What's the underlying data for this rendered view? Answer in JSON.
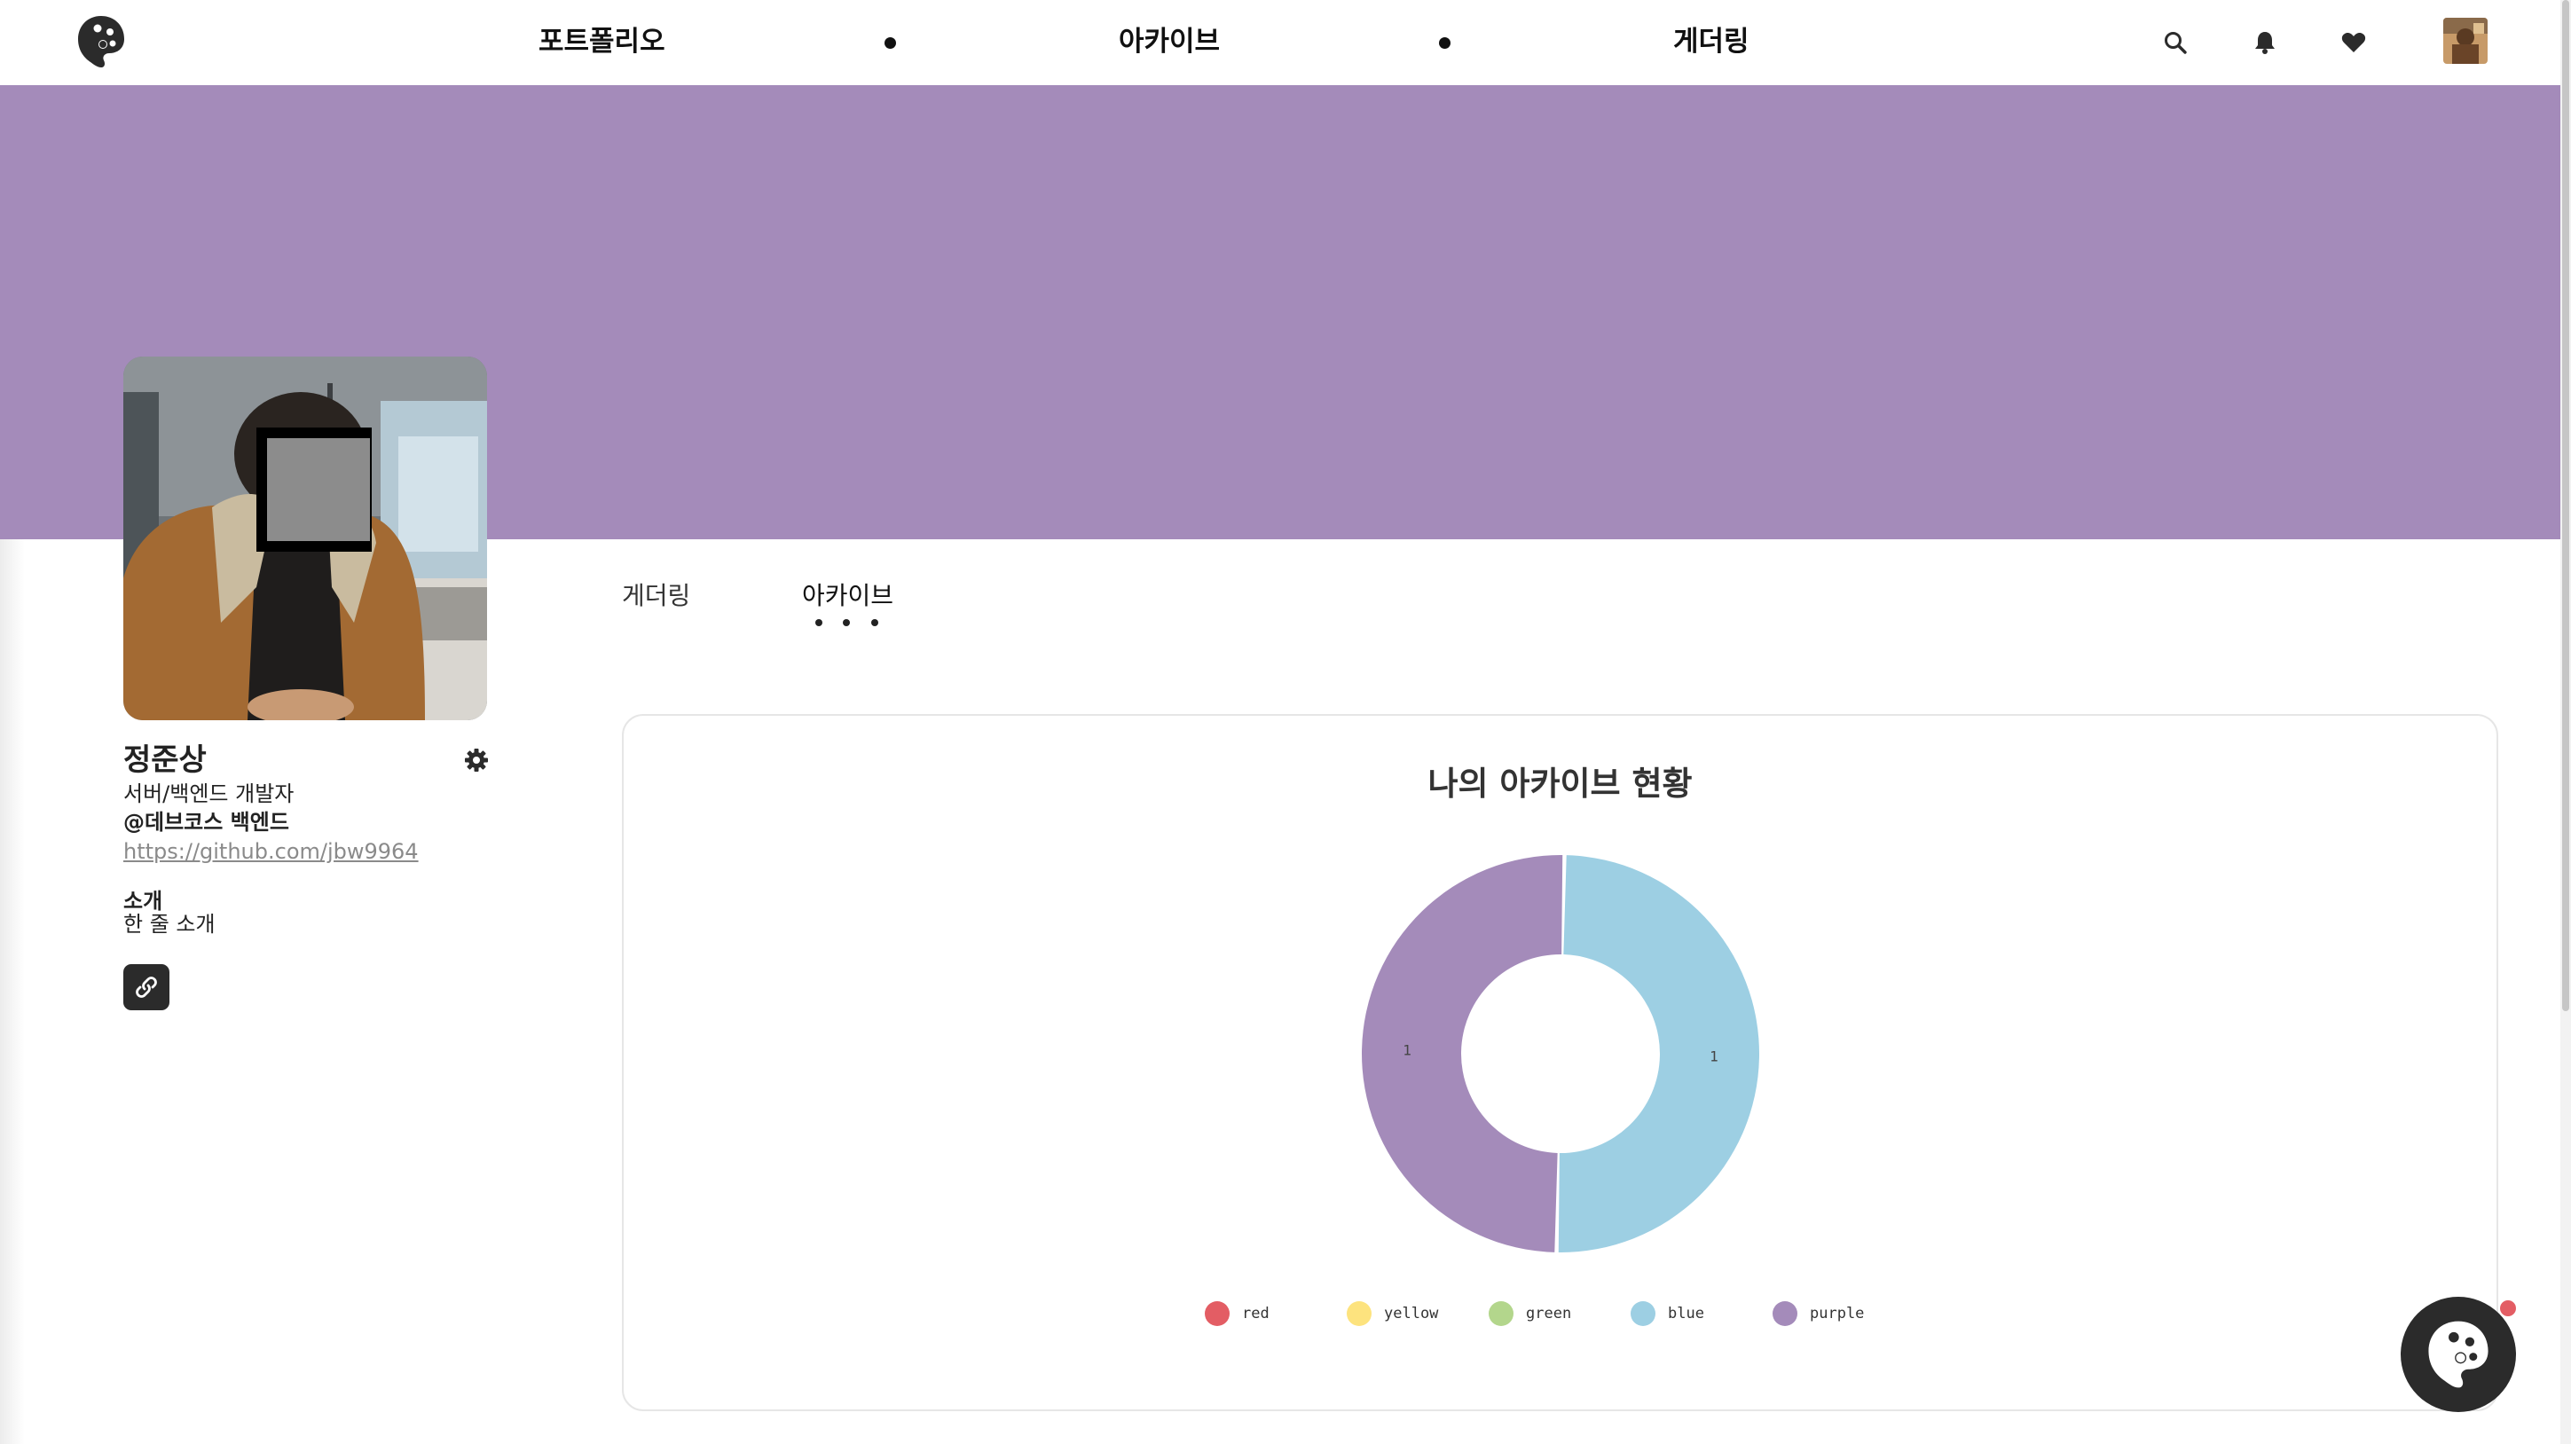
{
  "nav": {
    "items": [
      "포트폴리오",
      "아카이브",
      "게더링"
    ],
    "icons": [
      "logo-palette-icon",
      "search-icon",
      "bell-icon",
      "heart-icon"
    ]
  },
  "colors": {
    "banner": "#a48bba",
    "red": "#e35d64",
    "yellow": "#fde37e",
    "green": "#b3d68c",
    "blue": "#9dcfe3",
    "purple": "#a48bba",
    "dark": "#2b2b2b"
  },
  "profile": {
    "name": "정준상",
    "role": "서버/백엔드 개발자",
    "org": "@데브코스 백엔드",
    "link": "https://github.com/jbw9964",
    "intro_label": "소개",
    "intro_text": "한 줄 소개"
  },
  "tabs": {
    "items": [
      "게더링",
      "아카이브"
    ],
    "active": "아카이브"
  },
  "archive": {
    "title": "나의 아카이브 현황"
  },
  "chart_data": {
    "type": "pie",
    "title": "나의 아카이브 현황",
    "categories": [
      "red",
      "yellow",
      "green",
      "blue",
      "purple"
    ],
    "values": [
      0,
      0,
      0,
      1,
      1
    ],
    "colors": [
      "#e35d64",
      "#fde37e",
      "#b3d68c",
      "#9dcfe3",
      "#a48bba"
    ],
    "donut": true,
    "legend": "bottom"
  }
}
